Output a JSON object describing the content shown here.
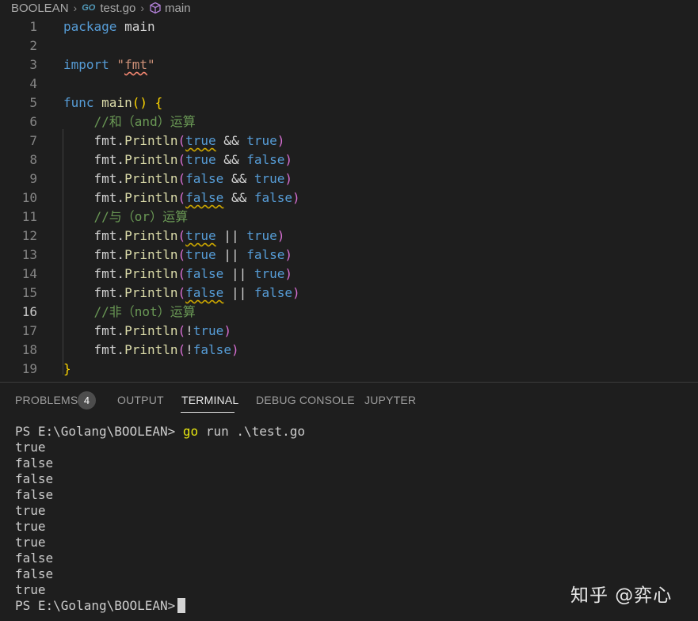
{
  "breadcrumb": {
    "folder": "BOOLEAN",
    "file": "test.go",
    "symbol": "main",
    "go_badge": "GO"
  },
  "editor": {
    "active_line": 16,
    "line_numbers": [
      "1",
      "2",
      "3",
      "4",
      "5",
      "6",
      "7",
      "8",
      "9",
      "10",
      "11",
      "12",
      "13",
      "14",
      "15",
      "16",
      "17",
      "18",
      "19"
    ],
    "lines": {
      "l1_kw": "package",
      "l1_name": " main",
      "l3_kw": "import",
      "l3_str_q1": " \"",
      "l3_str": "fmt",
      "l3_str_q2": "\"",
      "l5_kw": "func",
      "l5_name": " main",
      "l5_paren": "()",
      "l5_brace": " {",
      "l6_comment": "//和（and）运算",
      "l11_comment": "//与（or）运算",
      "l16_comment": "//非（not）运算",
      "l19_brace": "}"
    },
    "calls": [
      {
        "pkg": "fmt.",
        "fn": "Println",
        "a": "true",
        "op": " && ",
        "b": "true"
      },
      {
        "pkg": "fmt.",
        "fn": "Println",
        "a": "true",
        "op": " && ",
        "b": "false"
      },
      {
        "pkg": "fmt.",
        "fn": "Println",
        "a": "false",
        "op": " && ",
        "b": "true"
      },
      {
        "pkg": "fmt.",
        "fn": "Println",
        "a": "false",
        "op": " && ",
        "b": "false"
      },
      {
        "pkg": "fmt.",
        "fn": "Println",
        "a": "true",
        "op": " || ",
        "b": "true"
      },
      {
        "pkg": "fmt.",
        "fn": "Println",
        "a": "true",
        "op": " || ",
        "b": "false"
      },
      {
        "pkg": "fmt.",
        "fn": "Println",
        "a": "false",
        "op": " || ",
        "b": "true"
      },
      {
        "pkg": "fmt.",
        "fn": "Println",
        "a": "false",
        "op": " || ",
        "b": "false"
      },
      {
        "pkg": "fmt.",
        "fn": "Println",
        "a": "",
        "op": "!",
        "b": "true"
      },
      {
        "pkg": "fmt.",
        "fn": "Println",
        "a": "",
        "op": "!",
        "b": "false"
      }
    ],
    "paren_open": "(",
    "paren_close": ")",
    "indent": "    "
  },
  "panel": {
    "tabs": [
      "PROBLEMS",
      "OUTPUT",
      "TERMINAL",
      "DEBUG CONSOLE",
      "JUPYTER"
    ],
    "active_tab": "TERMINAL",
    "problems_count": "4"
  },
  "terminal": {
    "prompt1": "PS E:\\Golang\\BOOLEAN> ",
    "command_go": "go",
    "command_rest": " run .\\test.go",
    "output": [
      "true",
      "false",
      "false",
      "false",
      "true",
      "true",
      "true",
      "false",
      "false",
      "true"
    ],
    "prompt2": "PS E:\\Golang\\BOOLEAN>"
  },
  "watermark": "知乎 @弈心",
  "colors": {
    "background": "#1e1e1e",
    "keyword": "#569cd6",
    "function": "#dcdcaa",
    "string": "#ce9178",
    "comment": "#6a9955",
    "bracket_gold": "#ffd700",
    "bracket_purple": "#da70d6"
  },
  "icons": [
    "chevron-right-icon",
    "go-file-icon",
    "symbol-method-icon"
  ]
}
